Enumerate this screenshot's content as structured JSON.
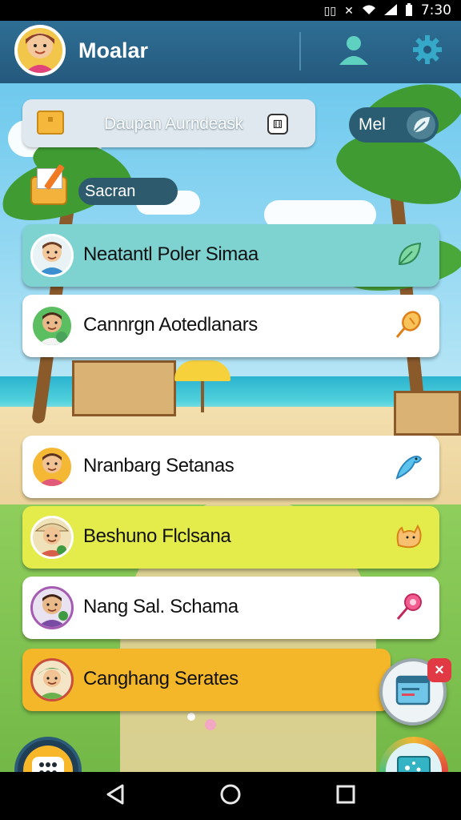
{
  "status_bar": {
    "time": "7:30",
    "icons": [
      "nfc-icon",
      "mute-icon",
      "wifi-icon",
      "signal-icon",
      "battery-icon"
    ]
  },
  "header": {
    "title": "Moalar",
    "profile_icon": "person-icon",
    "settings_icon": "gear-icon"
  },
  "search": {
    "text": "Daupan Aurndeask",
    "icon": "folder-icon",
    "trailing_icon": "dice-icon"
  },
  "me_button": {
    "label": "Mel",
    "icon": "leaf-icon"
  },
  "section": {
    "label": "Sacran",
    "icon": "mail-icon"
  },
  "list": {
    "items": [
      {
        "label": "Neatantl Poler Simaa",
        "color": "#7ed3d1",
        "action_icon": "leaf-icon",
        "action_color": "#4aa36a"
      },
      {
        "label": "Cannrgn Aotedlanars",
        "color": "#ffffff",
        "action_icon": "guitar-icon",
        "action_color": "#f08a1f"
      },
      {
        "label": "Nranbarg Setanas",
        "color": "#ffffff",
        "action_icon": "bird-icon",
        "action_color": "#3a9bd8"
      },
      {
        "label": "Beshuno Flclsana",
        "color": "#e3ec4a",
        "action_icon": "cat-icon",
        "action_color": "#f2a23b"
      },
      {
        "label": "Nang Sal. Schama",
        "color": "#ffffff",
        "action_icon": "pin-icon",
        "action_color": "#e2417b"
      },
      {
        "label": "Canghang Serates",
        "color": "#f5b72a",
        "action_icon": "",
        "action_color": ""
      }
    ]
  },
  "fabs": {
    "window_icon": "window-icon",
    "close_icon": "close-icon",
    "menu_icon": "grid-icon",
    "chat_icon": "chat-icon"
  },
  "nav": {
    "back": "back-icon",
    "home": "home-icon",
    "recents": "recents-icon"
  }
}
